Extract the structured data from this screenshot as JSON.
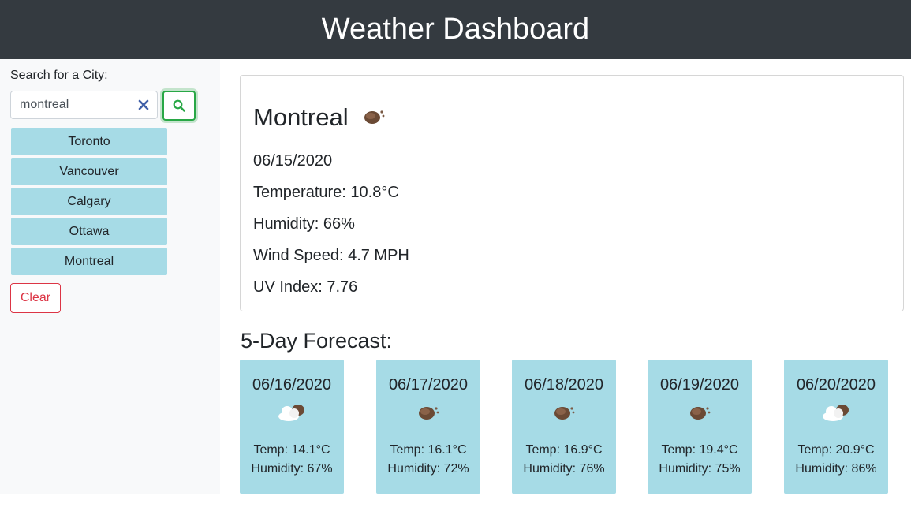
{
  "header": {
    "title": "Weather Dashboard"
  },
  "sidebar": {
    "search_label": "Search for a City:",
    "search_value": "montreal",
    "search_button_icon": "search-icon",
    "clear_icon": "close-icon",
    "cities": [
      "Toronto",
      "Vancouver",
      "Calgary",
      "Ottawa",
      "Montreal"
    ],
    "clear_label": "Clear"
  },
  "current": {
    "city": "Montreal",
    "icon": "rain-icon",
    "date": "06/15/2020",
    "temperature": "Temperature: 10.8°C",
    "humidity": "Humidity: 66%",
    "wind": "Wind Speed: 4.7 MPH",
    "uv": "UV Index: 7.76"
  },
  "forecast": {
    "title": "5-Day Forecast:",
    "days": [
      {
        "date": "06/16/2020",
        "icon": "cloud-icon",
        "temp": "Temp: 14.1°C",
        "humidity": "Humidity: 67%"
      },
      {
        "date": "06/17/2020",
        "icon": "rain-icon",
        "temp": "Temp: 16.1°C",
        "humidity": "Humidity: 72%"
      },
      {
        "date": "06/18/2020",
        "icon": "rain-icon",
        "temp": "Temp: 16.9°C",
        "humidity": "Humidity: 76%"
      },
      {
        "date": "06/19/2020",
        "icon": "rain-icon",
        "temp": "Temp: 19.4°C",
        "humidity": "Humidity: 75%"
      },
      {
        "date": "06/20/2020",
        "icon": "cloud-icon",
        "temp": "Temp: 20.9°C",
        "humidity": "Humidity: 86%"
      }
    ]
  },
  "colors": {
    "header_bg": "#343a40",
    "sidebar_bg": "#f8f9fa",
    "city_item_bg": "#a6dbe6",
    "search_button": "#28a745",
    "clear_button": "#dc3545"
  }
}
